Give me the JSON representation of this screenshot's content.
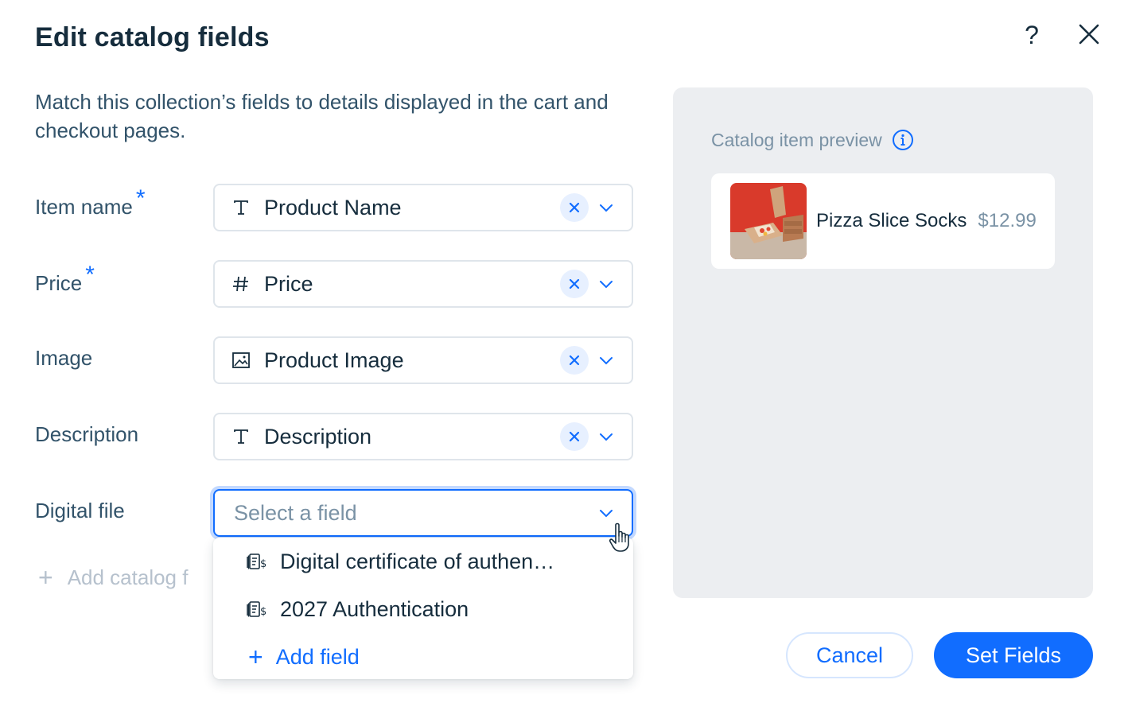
{
  "dialog": {
    "title": "Edit catalog fields",
    "help_label": "?",
    "subtitle": "Match this collection’s fields to details displayed in the cart and checkout pages."
  },
  "rows": [
    {
      "label": "Item name",
      "required": "*",
      "value": "Product Name",
      "icon": "text-type-icon"
    },
    {
      "label": "Price",
      "required": "*",
      "value": "Price",
      "icon": "number-type-icon"
    },
    {
      "label": "Image",
      "value": "Product Image",
      "icon": "image-type-icon"
    },
    {
      "label": "Description",
      "value": "Description",
      "icon": "text-type-icon"
    },
    {
      "label": "Digital file",
      "placeholder": "Select a field",
      "icon": "none"
    }
  ],
  "add_catalog_field": "Add catalog f",
  "dropdown": {
    "options": [
      {
        "label": "Digital certificate of authen…",
        "icon": "digital-file-icon"
      },
      {
        "label": "2027 Authentication",
        "icon": "digital-file-icon"
      }
    ],
    "add_field": "Add field"
  },
  "preview": {
    "label": "Catalog item preview",
    "product_name": "Pizza Slice Socks",
    "product_price": "$12.99"
  },
  "footer": {
    "cancel": "Cancel",
    "set_fields": "Set Fields"
  },
  "colors": {
    "accent": "#116dff",
    "text": "#162d3d",
    "muted": "#7a92a5",
    "panel": "#eceef1"
  }
}
